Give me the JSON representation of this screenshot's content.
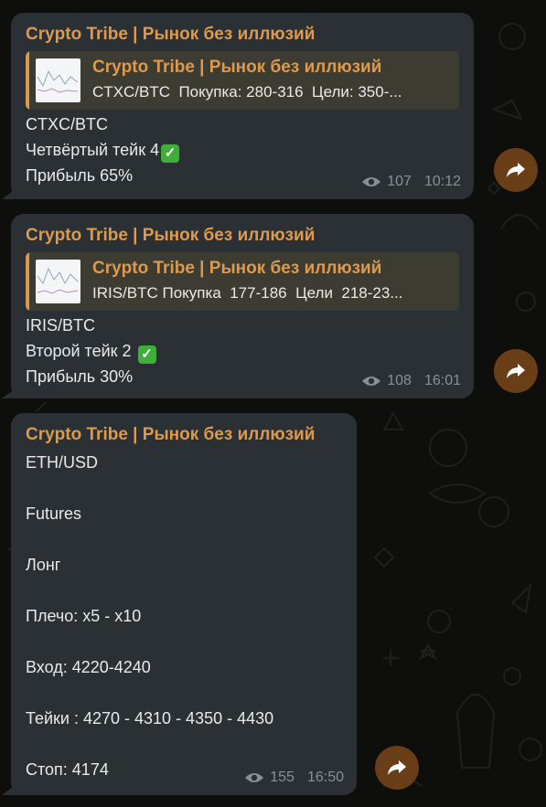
{
  "colors": {
    "background": "#0e0e0c",
    "bubble": "#2b3035",
    "accent": "#dd9a4c",
    "meta": "#8a9096",
    "share_button": "#6a3e17",
    "check": "#3fae3a"
  },
  "messages": [
    {
      "sender": "Crypto Tribe | Рынок без иллюзий",
      "reply": {
        "title": "Crypto Tribe | Рынок без иллюзий",
        "text": "CTXC/BTC  Покупка: 280-316  Цели: 350-..."
      },
      "lines": [
        "CTXC/BTC",
        "Четвёртый тейк 4",
        "Прибыль 65%"
      ],
      "check_icon": "check-mark-icon",
      "views": "107",
      "time": "10:12"
    },
    {
      "sender": "Crypto Tribe | Рынок без иллюзий",
      "reply": {
        "title": "Crypto Tribe | Рынок без иллюзий",
        "text": "IRIS/BTC Покупка  177-186  Цели  218-23..."
      },
      "lines": [
        "IRIS/BTC",
        "Второй тейк 2 ",
        "Прибыль 30%"
      ],
      "check_icon": "check-mark-icon",
      "views": "108",
      "time": "16:01"
    },
    {
      "sender": "Crypto Tribe | Рынок без иллюзий",
      "lines": [
        "ETH/USD",
        "Futures",
        "Лонг",
        "Плечо: x5 - x10",
        "Вход: 4220-4240",
        "Тейки : 4270 - 4310 - 4350 - 4430",
        "Стоп: 4174"
      ],
      "views": "155",
      "time": "16:50"
    }
  ]
}
